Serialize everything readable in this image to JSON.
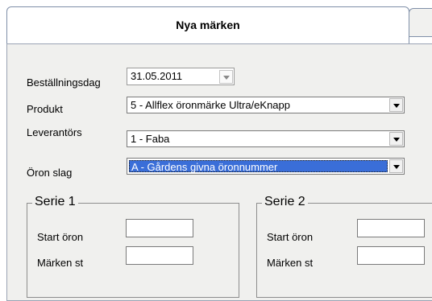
{
  "tabs": {
    "active_label": "Nya märken"
  },
  "form": {
    "order_date": {
      "label": "Beställningsdag",
      "value": "31.05.2011"
    },
    "product": {
      "label": "Produkt",
      "value": "5 - Allflex öronmärke Ultra/eKnapp"
    },
    "supplier": {
      "label": "Leverantörs",
      "value": "1 - Faba"
    },
    "ear_type": {
      "label": "Öron slag",
      "value": "A - Gårdens givna öronnummer"
    }
  },
  "series1": {
    "title": "Serie 1",
    "start_label": "Start öron",
    "count_label": "Märken st",
    "start_value": "",
    "count_value": ""
  },
  "series2": {
    "title": "Serie 2",
    "start_label": "Start öron",
    "count_label": "Märken st",
    "start_value": "",
    "count_value": ""
  }
}
